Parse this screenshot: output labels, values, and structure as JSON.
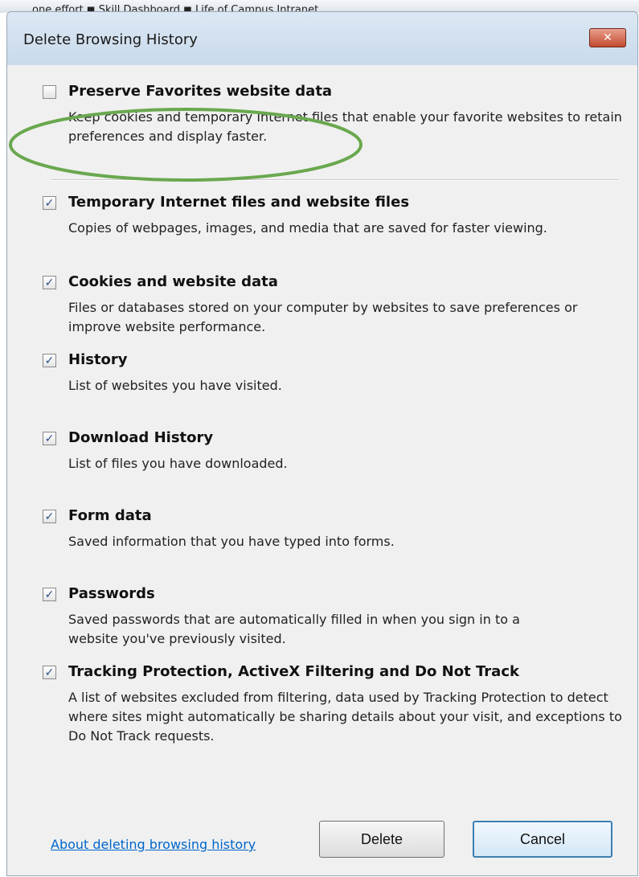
{
  "background_strip": {
    "text": "one effort  ◼  Skill Dashboard  ◼  Life of Campus Intranet"
  },
  "dialog": {
    "title": "Delete Browsing History",
    "close_label": "✕",
    "options": [
      {
        "label": "Preserve Favorites website data",
        "checked": false,
        "description": "Keep cookies and temporary Internet files that enable your favorite websites to retain preferences and display faster."
      },
      {
        "label": "Temporary Internet files and website files",
        "checked": true,
        "description": "Copies of webpages, images, and media that are saved for faster viewing."
      },
      {
        "label": "Cookies and website data",
        "checked": true,
        "description": "Files or databases stored on your computer by websites to save preferences or improve website performance."
      },
      {
        "label": "History",
        "checked": true,
        "description": "List of websites you have visited."
      },
      {
        "label": "Download History",
        "checked": true,
        "description": "List of files you have downloaded."
      },
      {
        "label": "Form data",
        "checked": true,
        "description": "Saved information that you have typed into forms."
      },
      {
        "label": "Passwords",
        "checked": true,
        "description": "Saved passwords that are automatically filled in when you sign in to a website you've previously visited."
      },
      {
        "label": "Tracking Protection, ActiveX Filtering and Do Not Track",
        "checked": true,
        "description": "A list of websites excluded from filtering, data used by Tracking Protection to detect where sites might automatically be sharing details about your visit, and exceptions to Do Not Track requests."
      }
    ],
    "help_link": "About deleting browsing history",
    "delete_button": "Delete",
    "cancel_button": "Cancel",
    "annotation_color": "#6aa84f",
    "checkmark": "✓"
  }
}
